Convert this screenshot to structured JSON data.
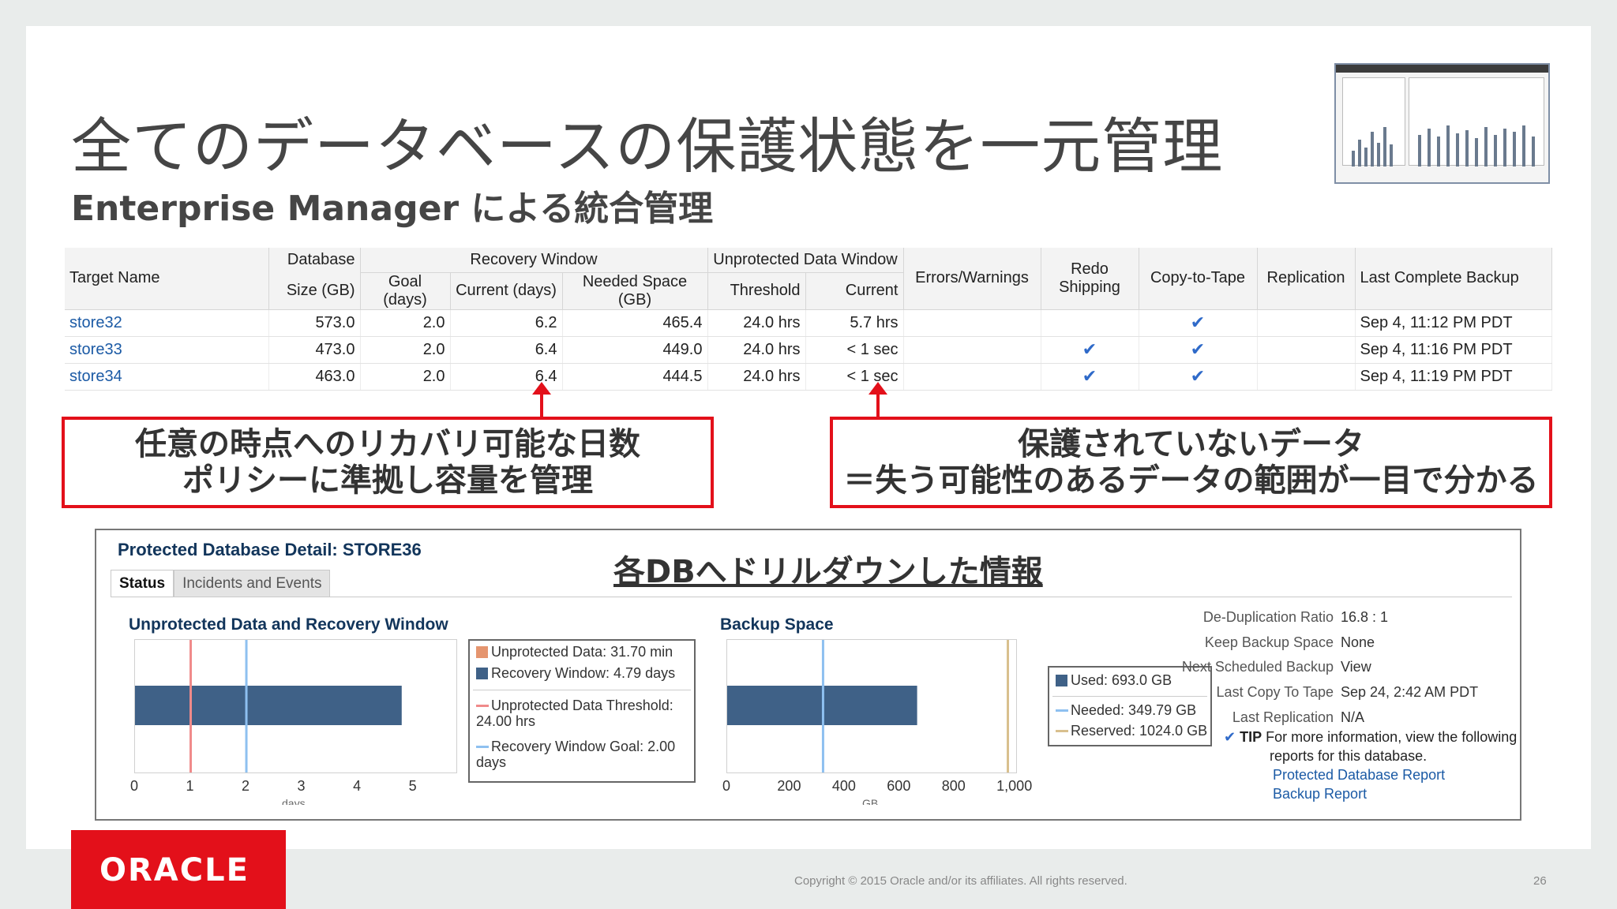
{
  "slide": {
    "title": "全てのデータベースの保護状態を一元管理",
    "subtitle": "Enterprise Manager による統合管理",
    "copyright": "Copyright © 2015 Oracle and/or its affiliates. All rights reserved.",
    "page_number": "26",
    "logo_text": "ORACLE"
  },
  "table": {
    "headers": {
      "target_name": "Target Name",
      "db_size": "Database",
      "db_size2": "Size (GB)",
      "recovery_window": "Recovery Window",
      "goal": "Goal (days)",
      "current_days": "Current (days)",
      "needed_space": "Needed Space (GB)",
      "unprotected": "Unprotected Data Window",
      "threshold": "Threshold",
      "current": "Current",
      "errors": "Errors/Warnings",
      "redo": "Redo",
      "redo2": "Shipping",
      "copy_to_tape": "Copy-to-Tape",
      "replication": "Replication",
      "last_backup": "Last Complete Backup"
    },
    "rows": [
      {
        "name": "store32",
        "size": "573.0",
        "goal": "2.0",
        "current": "6.2",
        "needed": "465.4",
        "threshold": "24.0 hrs",
        "unprot": "5.7 hrs",
        "errors": "",
        "redo": "",
        "tape": "✔",
        "repl": "",
        "last": "Sep 4, 11:12 PM PDT"
      },
      {
        "name": "store33",
        "size": "473.0",
        "goal": "2.0",
        "current": "6.4",
        "needed": "449.0",
        "threshold": "24.0 hrs",
        "unprot": "< 1 sec",
        "errors": "",
        "redo": "✔",
        "tape": "✔",
        "repl": "",
        "last": "Sep 4, 11:16 PM PDT"
      },
      {
        "name": "store34",
        "size": "463.0",
        "goal": "2.0",
        "current": "6.4",
        "needed": "444.5",
        "threshold": "24.0 hrs",
        "unprot": "< 1 sec",
        "errors": "",
        "redo": "✔",
        "tape": "✔",
        "repl": "",
        "last": "Sep 4, 11:19 PM PDT"
      }
    ]
  },
  "callouts": {
    "left_line1": "任意の時点へのリカバリ可能な日数",
    "left_line2": "ポリシーに準拠し容量を管理",
    "right_line1": "保護されていないデータ",
    "right_line2": "＝失う可能性のあるデータの範囲が一目で分かる"
  },
  "detail": {
    "title": "Protected Database Detail: STORE36",
    "drilldown_caption": "各DBへドリルダウンした情報",
    "tabs": [
      "Status",
      "Incidents and Events"
    ],
    "unprotected_section": "Unprotected Data and Recovery Window",
    "backup_section": "Backup Space",
    "legend1": {
      "unprotected": "Unprotected Data: 31.70 min",
      "recovery": "Recovery Window: 4.79 days",
      "threshold_a": "Unprotected Data Threshold:",
      "threshold_b": "24.00 hrs",
      "goal_a": "Recovery Window Goal: 2.00",
      "goal_b": "days"
    },
    "legend2": {
      "used": "Used: 693.0 GB",
      "needed": "Needed: 349.79 GB",
      "reserved": "Reserved: 1024.0 GB"
    },
    "axis1_ticks": [
      "0",
      "1",
      "2",
      "3",
      "4",
      "5"
    ],
    "axis1_label": "days",
    "axis2_ticks": [
      "0",
      "200",
      "400",
      "600",
      "800",
      "1,000"
    ],
    "axis2_label": "GB",
    "info": {
      "dedup_k": "De-Duplication Ratio",
      "dedup_v": "16.8 : 1",
      "keep_k": "Keep Backup Space",
      "keep_v": "None",
      "next_k": "Next Scheduled Backup",
      "next_v": "View",
      "tape_k": "Last Copy To Tape",
      "tape_v": "Sep 24, 2:42 AM PDT",
      "repl_k": "Last Replication",
      "repl_v": "N/A",
      "tip_label": "TIP",
      "tip_text1": "For more information, view the following",
      "tip_text2": "reports for this database.",
      "report1": "Protected Database Report",
      "report2": "Backup Report"
    }
  },
  "chart_data": [
    {
      "type": "bar",
      "title": "Unprotected Data and Recovery Window",
      "xlabel": "days",
      "xlim": [
        0,
        5.8
      ],
      "series": [
        {
          "name": "Recovery Window",
          "values": [
            4.79
          ]
        }
      ],
      "markers": {
        "Unprotected Data Threshold": 1.0,
        "Recovery Window Goal": 2.0
      },
      "colors": {
        "bar": "#3f6187",
        "threshold": "#f08a8a",
        "goal": "#8ec0f0"
      }
    },
    {
      "type": "bar",
      "title": "Backup Space",
      "xlabel": "GB",
      "xlim": [
        0,
        1060
      ],
      "series": [
        {
          "name": "Used",
          "values": [
            693.0
          ]
        }
      ],
      "markers": {
        "Needed": 349.79,
        "Reserved": 1024.0
      },
      "colors": {
        "bar": "#3f6187",
        "needed": "#8ec0f0",
        "reserved": "#d9c08e"
      }
    }
  ]
}
